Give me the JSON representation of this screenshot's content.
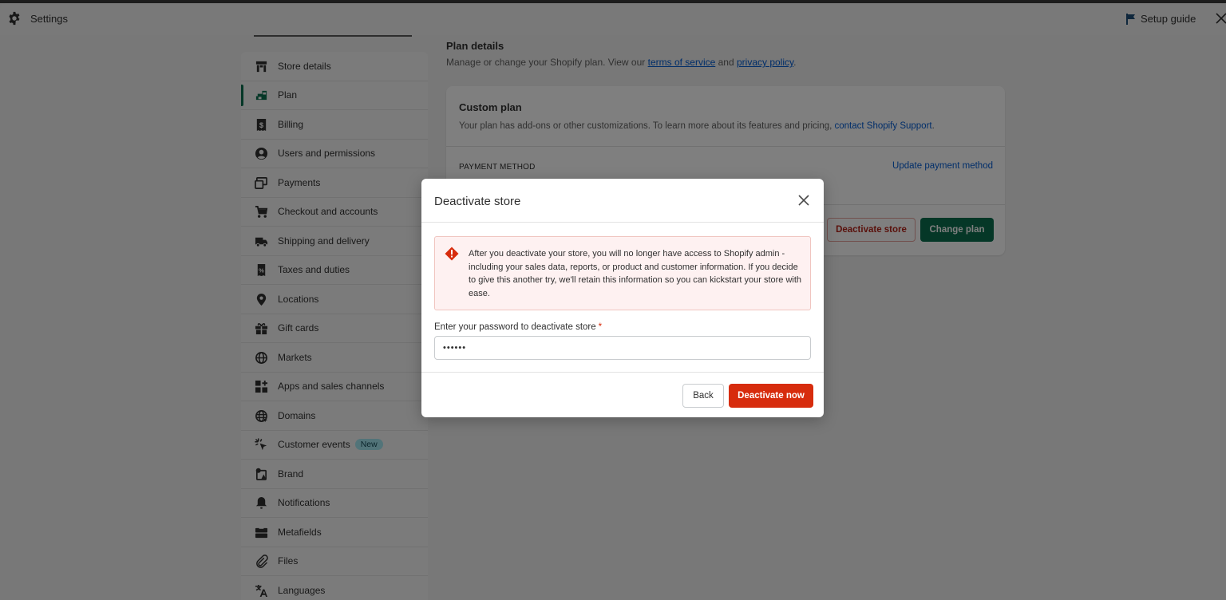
{
  "header": {
    "title": "Settings",
    "setup_guide_label": "Setup guide"
  },
  "sidebar": {
    "active_index": 1,
    "items": [
      {
        "label": "Store details",
        "icon": "store-icon"
      },
      {
        "label": "Plan",
        "icon": "plan-icon"
      },
      {
        "label": "Billing",
        "icon": "billing-icon"
      },
      {
        "label": "Users and permissions",
        "icon": "user-icon"
      },
      {
        "label": "Payments",
        "icon": "payments-icon"
      },
      {
        "label": "Checkout and accounts",
        "icon": "cart-icon"
      },
      {
        "label": "Shipping and delivery",
        "icon": "truck-icon"
      },
      {
        "label": "Taxes and duties",
        "icon": "tax-icon"
      },
      {
        "label": "Locations",
        "icon": "location-icon"
      },
      {
        "label": "Gift cards",
        "icon": "gift-icon"
      },
      {
        "label": "Markets",
        "icon": "globe-icon"
      },
      {
        "label": "Apps and sales channels",
        "icon": "apps-icon"
      },
      {
        "label": "Domains",
        "icon": "domain-icon"
      },
      {
        "label": "Customer events",
        "icon": "cursor-click-icon",
        "badge": "New"
      },
      {
        "label": "Brand",
        "icon": "brand-icon"
      },
      {
        "label": "Notifications",
        "icon": "bell-icon"
      },
      {
        "label": "Metafields",
        "icon": "metafields-icon"
      },
      {
        "label": "Files",
        "icon": "paperclip-icon"
      },
      {
        "label": "Languages",
        "icon": "translate-icon"
      }
    ]
  },
  "main": {
    "title": "Plan details",
    "subtitle_prefix": "Manage or change your Shopify plan. View our ",
    "terms_link": "terms of service",
    "subtitle_and": " and ",
    "privacy_link": "privacy policy",
    "subtitle_suffix": ".",
    "card": {
      "plan_name": "Custom plan",
      "plan_desc": "Your plan has add-ons or other customizations. To learn more about its features and pricing, ",
      "support_link": "contact Shopify Support",
      "plan_desc_suffix": ".",
      "payment_method_label": "PAYMENT METHOD",
      "update_payment_link": "Update payment method",
      "deactivate_button": "Deactivate store",
      "change_plan_button": "Change plan"
    }
  },
  "modal": {
    "title": "Deactivate store",
    "alert_text": "After you deactivate your store, you will no longer have access to Shopify admin - including your sales data, reports, or product and customer information. If you decide to give this another try, we'll retain this information so you can kickstart your store with ease.",
    "password_label": "Enter your password to deactivate store",
    "required_mark": "*",
    "password_value": "••••••",
    "back_button": "Back",
    "deactivate_now_button": "Deactivate now"
  },
  "colors": {
    "brand_green": "#0b6e4f",
    "critical_red": "#d72c0d",
    "link_blue": "#005bd3",
    "badge_bg": "#a4e8f2"
  }
}
